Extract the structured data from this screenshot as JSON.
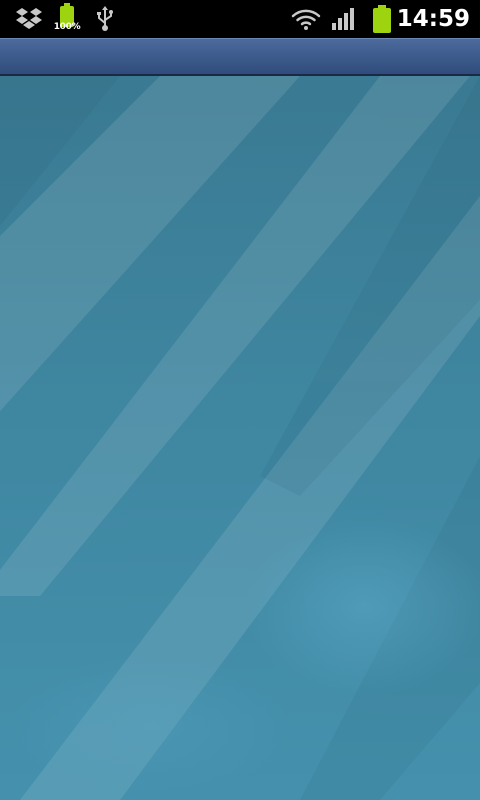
{
  "status_bar": {
    "time": "14:59",
    "battery_level_label": "100%",
    "notification_icons": [
      "dropbox-icon",
      "battery-full-notification-icon",
      "usb-icon"
    ],
    "system_icons": [
      "wifi-icon",
      "signal-bars-icon",
      "battery-icon"
    ]
  },
  "colors": {
    "status_bar_bg": "#000000",
    "title_bar_top": "#4c6b9c",
    "title_bar_bottom": "#2f4c7c",
    "content_bg": "#3d839b",
    "battery_green": "#9ed40f"
  }
}
